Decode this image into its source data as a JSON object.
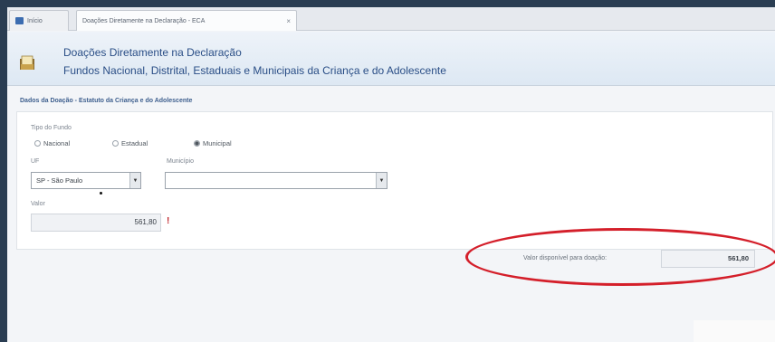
{
  "tabs": [
    {
      "label": "Início"
    },
    {
      "label": "Doações Diretamente na Declaração - ECA",
      "close": "×"
    }
  ],
  "header": {
    "title_line1": "Doações Diretamente na Declaração",
    "title_line2": "Fundos Nacional, Distrital, Estaduais e Municipais da Criança e do Adolescente"
  },
  "section": {
    "label": "Dados da Doação - Estatuto da Criança e do Adolescente"
  },
  "form": {
    "tipo_fundo_label": "Tipo do Fundo",
    "radios": [
      {
        "label": "Nacional",
        "checked": false
      },
      {
        "label": "Estadual",
        "checked": false
      },
      {
        "label": "Municipal",
        "checked": true
      }
    ],
    "uf_label": "UF",
    "uf_value": "SP - São Paulo",
    "municipio_label": "Município",
    "municipio_value": "",
    "valor_label": "Valor",
    "valor_value": "561,80",
    "required_mark": "!"
  },
  "disponivel": {
    "label": "Valor disponível para doação:",
    "value": "561,80"
  },
  "colors": {
    "accent": "#2a4e86",
    "highlight_circle": "#d41f2a",
    "background": "#2a3d52"
  }
}
